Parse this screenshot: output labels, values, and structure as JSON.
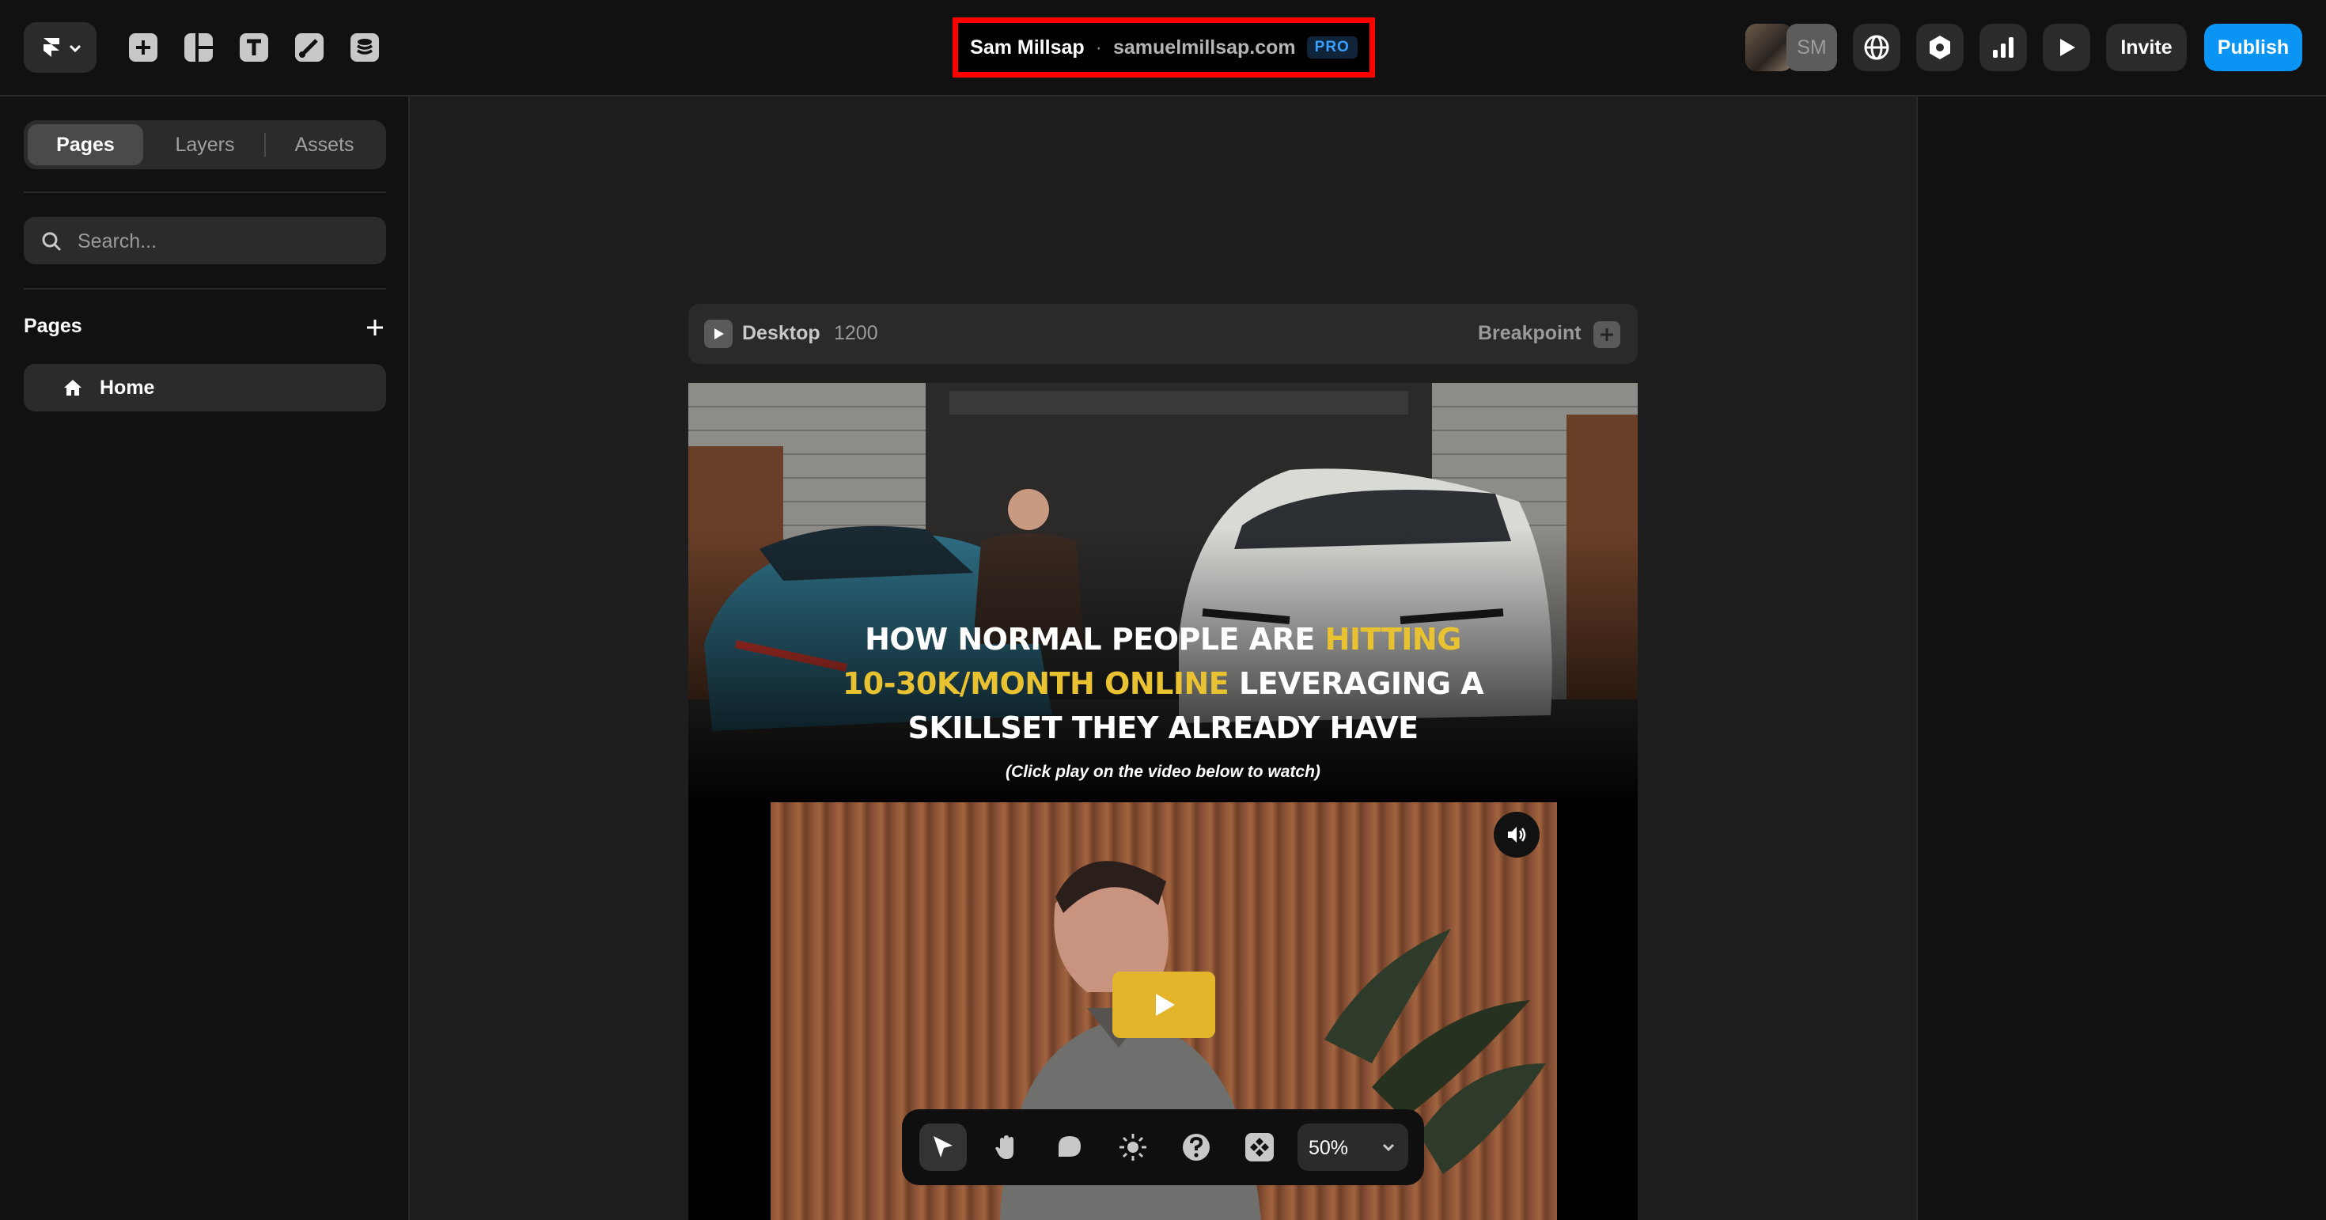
{
  "topbar": {
    "project_owner": "Sam Millsap",
    "separator": "·",
    "domain": "samuelmillsap.com",
    "plan_badge": "PRO",
    "avatar_initials": "SM",
    "invite_label": "Invite",
    "publish_label": "Publish"
  },
  "sidebar": {
    "tabs": [
      {
        "label": "Pages",
        "active": true
      },
      {
        "label": "Layers",
        "active": false
      },
      {
        "label": "Assets",
        "active": false
      }
    ],
    "search_placeholder": "Search...",
    "section_title": "Pages",
    "pages": [
      {
        "label": "Home",
        "icon": "home-icon"
      }
    ]
  },
  "breakpoint_bar": {
    "device": "Desktop",
    "width": "1200",
    "breakpoint_label": "Breakpoint"
  },
  "hero": {
    "headline_parts": [
      "HOW NORMAL PEOPLE ARE ",
      "HITTING",
      "10-30K/MONTH ONLINE",
      " LEVERAGING A",
      "SKILLSET THEY ALREADY HAVE"
    ],
    "subnote": "(Click play on the video below to watch)"
  },
  "bottom_toolbar": {
    "zoom": "50%"
  },
  "colors": {
    "publish": "#0a95f5",
    "highlight_box": "#ff0000",
    "headline_accent": "#e9c232",
    "pro_badge": "#3aa0ff",
    "play_button": "#e2b52b"
  }
}
